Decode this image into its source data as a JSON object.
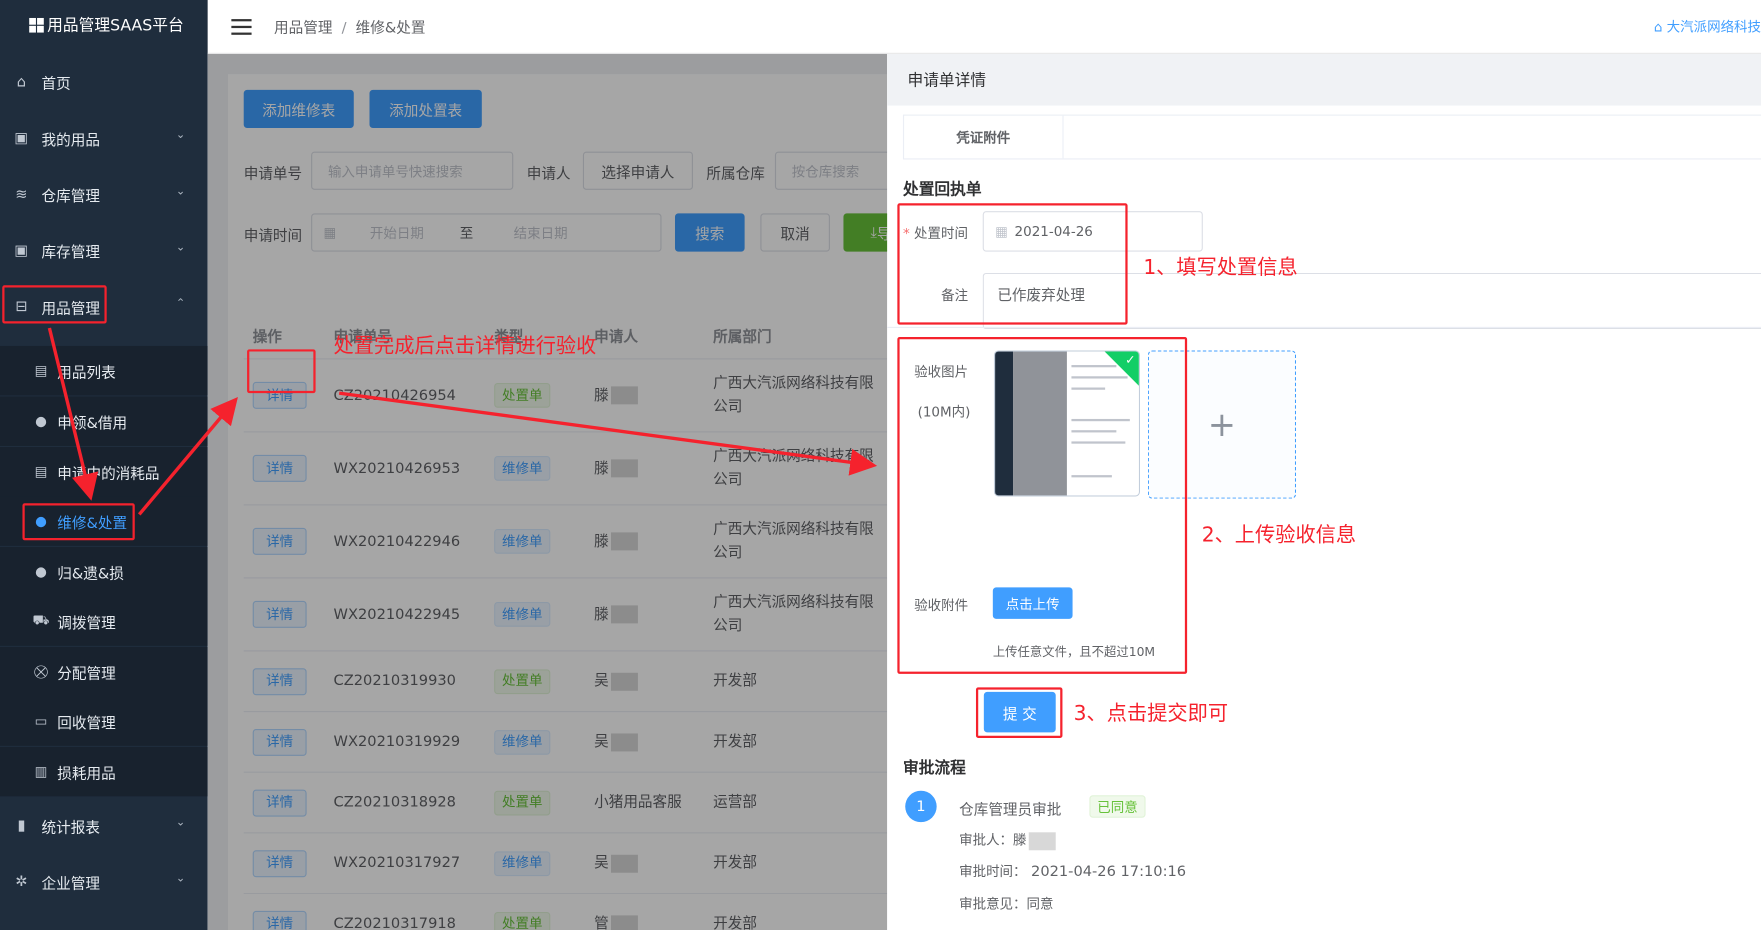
{
  "app_title": "用品管理SAAS平台",
  "sidebar": {
    "items": [
      {
        "label": "首页",
        "icon": "home-icon"
      },
      {
        "label": "我的用品",
        "icon": "bag-icon"
      },
      {
        "label": "仓库管理",
        "icon": "database-icon"
      },
      {
        "label": "库存管理",
        "icon": "box-icon"
      },
      {
        "label": "用品管理",
        "icon": "inbox-icon"
      },
      {
        "label": "统计报表",
        "icon": "bar-chart-icon"
      },
      {
        "label": "企业管理",
        "icon": "gear-icon"
      }
    ],
    "sub_items": [
      {
        "label": "用品列表",
        "icon": "document-icon"
      },
      {
        "label": "申领&借用",
        "icon": "user-icon"
      },
      {
        "label": "申请中的消耗品",
        "icon": "document-icon"
      },
      {
        "label": "维修&处置",
        "icon": "user-icon"
      },
      {
        "label": "归&遗&损",
        "icon": "user-icon"
      },
      {
        "label": "调拨管理",
        "icon": "truck-icon"
      },
      {
        "label": "分配管理",
        "icon": "cart-icon"
      },
      {
        "label": "回收管理",
        "icon": "monitor-icon"
      },
      {
        "label": "损耗用品",
        "icon": "trash-icon"
      }
    ]
  },
  "breadcrumb": {
    "parent": "用品管理",
    "separator": "/",
    "current": "维修&处置"
  },
  "company": "大汽派网络科技",
  "toolbar": {
    "add_repair": "添加维修表",
    "add_dispose": "添加处置表"
  },
  "filters": {
    "apply_no_label": "申请单号",
    "apply_no_placeholder": "输入申请单号快速搜索",
    "applicant_label": "申请人",
    "applicant_button": "选择申请人",
    "warehouse_label": "所属仓库",
    "warehouse_placeholder": "按仓库搜索",
    "time_label": "申请时间",
    "start_placeholder": "开始日期",
    "to": "至",
    "end_placeholder": "结束日期",
    "search": "搜索",
    "cancel": "取消",
    "export": "导出"
  },
  "table": {
    "headers": [
      "操作",
      "申请单号",
      "类型",
      "申请人",
      "所属部门"
    ],
    "action_label": "详情",
    "rows": [
      {
        "no": "CZ20210426954",
        "type": "处置单",
        "applicant": "滕",
        "dept": "广西大汽派网络科技有限公司"
      },
      {
        "no": "WX20210426953",
        "type": "维修单",
        "applicant": "滕",
        "dept": "广西大汽派网络科技有限公司"
      },
      {
        "no": "WX20210422946",
        "type": "维修单",
        "applicant": "滕",
        "dept": "广西大汽派网络科技有限公司"
      },
      {
        "no": "WX20210422945",
        "type": "维修单",
        "applicant": "滕",
        "dept": "广西大汽派网络科技有限公司"
      },
      {
        "no": "CZ20210319930",
        "type": "处置单",
        "applicant": "吴",
        "dept": "开发部"
      },
      {
        "no": "WX20210319929",
        "type": "维修单",
        "applicant": "吴",
        "dept": "开发部"
      },
      {
        "no": "CZ20210318928",
        "type": "处置单",
        "applicant": "小猪用品客服",
        "dept": "运营部"
      },
      {
        "no": "WX20210317927",
        "type": "维修单",
        "applicant": "吴",
        "dept": "开发部"
      },
      {
        "no": "CZ20210317918",
        "type": "处置单",
        "applicant": "管",
        "dept": "开发部"
      }
    ]
  },
  "drawer": {
    "title": "申请单详情",
    "voucher_label": "凭证附件",
    "receipt_title": "处置回执单",
    "dispose_time_label": "处置时间",
    "dispose_time_value": "2021-04-26",
    "remark_label": "备注",
    "remark_value": "已作废弃处理",
    "accept_image_label": "验收图片",
    "accept_image_hint": "(10M内)",
    "accept_attach_label": "验收附件",
    "upload_button": "点击上传",
    "upload_tip": "上传任意文件，且不超过10M",
    "submit": "提 交",
    "flow_title": "审批流程",
    "step_no": "1",
    "step_name": "仓库管理员审批",
    "step_status": "已同意",
    "approver_label": "审批人：",
    "approver_value": "滕",
    "approve_time_label": "审批时间：",
    "approve_time_value": "2021-04-26 17:10:16",
    "opinion_label": "审批意见：",
    "opinion_value": "同意"
  },
  "annotations": {
    "detail_hint": "处置完成后点击详情进行验收",
    "step1": "1、填写处置信息",
    "step2": "2、上传验收信息",
    "step3": "3、点击提交即可"
  },
  "colors": {
    "primary": "#409eff",
    "success": "#67c23a",
    "sidebar": "#1f2d3d",
    "annotation": "#f5222d"
  }
}
